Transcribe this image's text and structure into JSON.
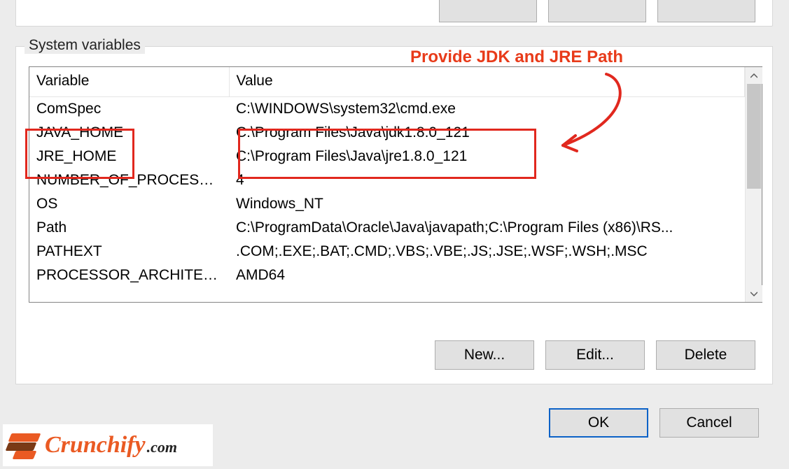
{
  "group": {
    "title": "System variables"
  },
  "columns": {
    "variable": "Variable",
    "value": "Value"
  },
  "rows": [
    {
      "name": "ComSpec",
      "value": "C:\\WINDOWS\\system32\\cmd.exe"
    },
    {
      "name": "JAVA_HOME",
      "value": "C:\\Program Files\\Java\\jdk1.8.0_121"
    },
    {
      "name": "JRE_HOME",
      "value": "C:\\Program Files\\Java\\jre1.8.0_121"
    },
    {
      "name": "NUMBER_OF_PROCESSORS",
      "value": "4"
    },
    {
      "name": "OS",
      "value": "Windows_NT"
    },
    {
      "name": "Path",
      "value": "C:\\ProgramData\\Oracle\\Java\\javapath;C:\\Program Files (x86)\\RS..."
    },
    {
      "name": "PATHEXT",
      "value": ".COM;.EXE;.BAT;.CMD;.VBS;.VBE;.JS;.JSE;.WSF;.WSH;.MSC"
    },
    {
      "name": "PROCESSOR_ARCHITECTURE",
      "value": "AMD64"
    }
  ],
  "buttons": {
    "new": "New...",
    "edit": "Edit...",
    "delete": "Delete",
    "ok": "OK",
    "cancel": "Cancel"
  },
  "annotation": {
    "text": "Provide JDK and JRE Path"
  },
  "brand": {
    "name": "Crunchify",
    "suffix": ".com"
  },
  "colors": {
    "accent": "#e83b1a",
    "winButtonBorder": "#adadad",
    "primaryBorder": "#0c62c7"
  }
}
